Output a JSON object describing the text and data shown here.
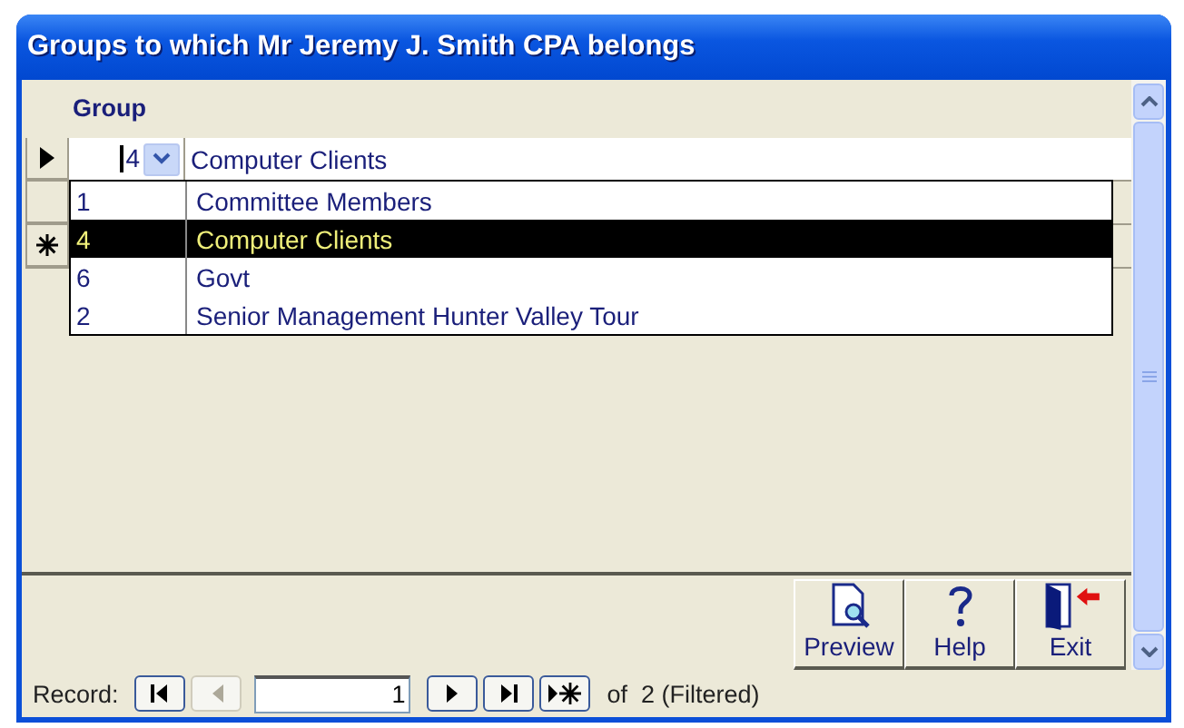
{
  "window": {
    "title": "Groups to which Mr Jeremy J. Smith CPA belongs"
  },
  "column_header": "Group",
  "rows": [
    {
      "kind": "current",
      "group_id": "4",
      "group_name": "Computer Clients"
    },
    {
      "kind": "record"
    },
    {
      "kind": "new"
    }
  ],
  "dropdown": [
    {
      "id": "1",
      "name": "Committee Members",
      "selected": false
    },
    {
      "id": "4",
      "name": "Computer Clients",
      "selected": true
    },
    {
      "id": "6",
      "name": "Govt",
      "selected": false
    },
    {
      "id": "2",
      "name": "Senior Management Hunter Valley Tour",
      "selected": false
    }
  ],
  "buttons": [
    {
      "kind": "preview",
      "label": "Preview"
    },
    {
      "kind": "help",
      "label": "Help"
    },
    {
      "kind": "exit",
      "label": "Exit"
    }
  ],
  "navigation": {
    "label": "Record:",
    "current": "1",
    "total": "of  2 (Filtered)",
    "previous_disabled": true
  }
}
